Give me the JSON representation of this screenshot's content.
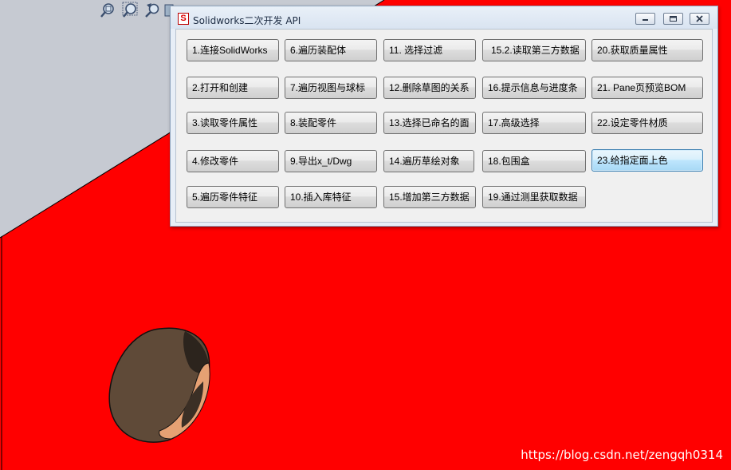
{
  "dialog": {
    "title": "Solidworks二次开发 API",
    "app_icon_letter": "S"
  },
  "buttons": {
    "r1": [
      "1.连接SolidWorks",
      "6.遍历装配体",
      "11. 选择过滤",
      "15.2.读取第三方数据",
      "20.获取质量属性"
    ],
    "r2": [
      "2.打开和创建",
      "7.遍历视图与球标",
      "12.删除草图的关系",
      "16.提示信息与进度条",
      "21. Pane页预览BOM"
    ],
    "r3": [
      "3.读取零件属性",
      "8.装配零件",
      "13.选择已命名的面",
      "17.高级选择",
      "22.设定零件材质"
    ],
    "r4": [
      "4.修改零件",
      "9.导出x_t/Dwg",
      "14.遍历草绘对象",
      "18.包围盒",
      "23.给指定面上色"
    ],
    "r5": [
      "5.遍历零件特征",
      "10.插入库特征",
      "15.增加第三方数据",
      "19.通过测里获取数据"
    ]
  },
  "toolbar": {
    "icons": [
      "zoom-to-fit-icon",
      "zoom-to-area-icon",
      "previous-view-icon",
      "section-view-icon"
    ]
  },
  "watermark": "https://blog.csdn.net/zengqh0314",
  "colors": {
    "viewport_background": "#c6cad2",
    "part_face": "#ff0000",
    "hole_dark": "#4a3a2c",
    "hole_ring": "#e6a173",
    "dialog_frame": "#e7eef7",
    "focused_button_border": "#3c7fb1"
  }
}
